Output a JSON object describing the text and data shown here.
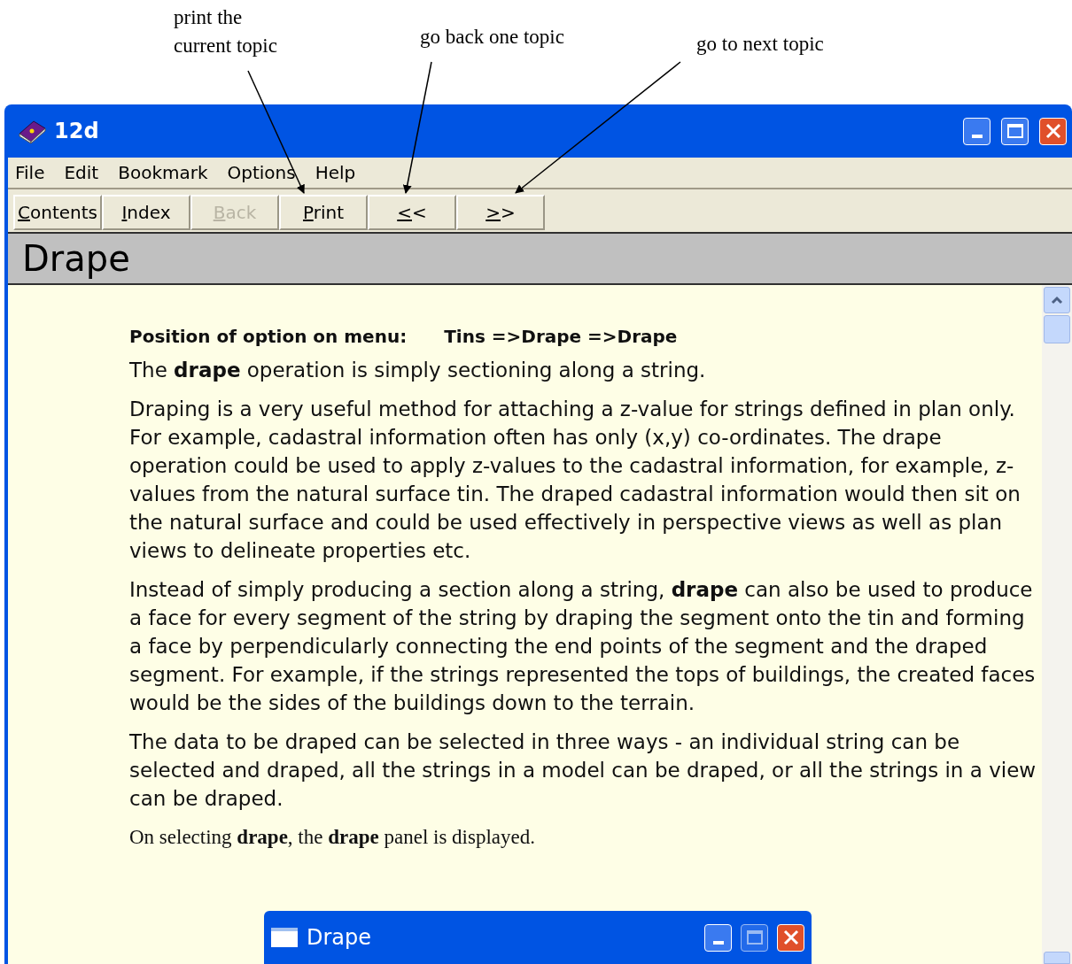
{
  "annotations": [
    {
      "text": "print the\ncurrent topic"
    },
    {
      "text": "go back one topic"
    },
    {
      "text": "go to next topic"
    }
  ],
  "window": {
    "title": "12d"
  },
  "menu": [
    "File",
    "Edit",
    "Bookmark",
    "Options",
    "Help"
  ],
  "toolbar": [
    {
      "label": "Contents",
      "disabled": false
    },
    {
      "label": "Index",
      "disabled": false
    },
    {
      "label": "Back",
      "disabled": true
    },
    {
      "label": "Print",
      "disabled": false
    },
    {
      "label": "<<",
      "disabled": false
    },
    {
      "label": ">>",
      "disabled": false
    }
  ],
  "topic_title": "Drape",
  "content": {
    "position_label": "Position of option on menu:",
    "position_value": "Tins =>Drape =>Drape",
    "paragraphs": [
      "The **drape** operation is simply sectioning along a string.",
      "Draping is a very useful method for attaching a z-value for strings defined in plan only. For example, cadastral information often has only (x,y) co-ordinates. The drape operation could be used to apply z-values to the cadastral information, for example, z-values from the natural surface tin. The draped cadastral information would then sit on the natural surface and could be used effectively in perspective views as well as plan views to delineate properties etc.",
      "Instead of simply producing a section along a string, **drape** can also be used to produce a face for every segment of the string by draping the segment onto the tin and forming a face by perpendicularly connecting the end points of the segment and the draped segment. For example, if the strings represented the tops of buildings, the created faces would be the sides of the buildings down to the terrain.",
      "The data to be draped can be selected in three ways - an individual string can be selected and draped, all the strings in a model can be draped, or all the strings in a view can be draped."
    ],
    "closing": "On selecting **drape**, the **drape** panel is displayed."
  },
  "sub_window": {
    "title": "Drape"
  }
}
